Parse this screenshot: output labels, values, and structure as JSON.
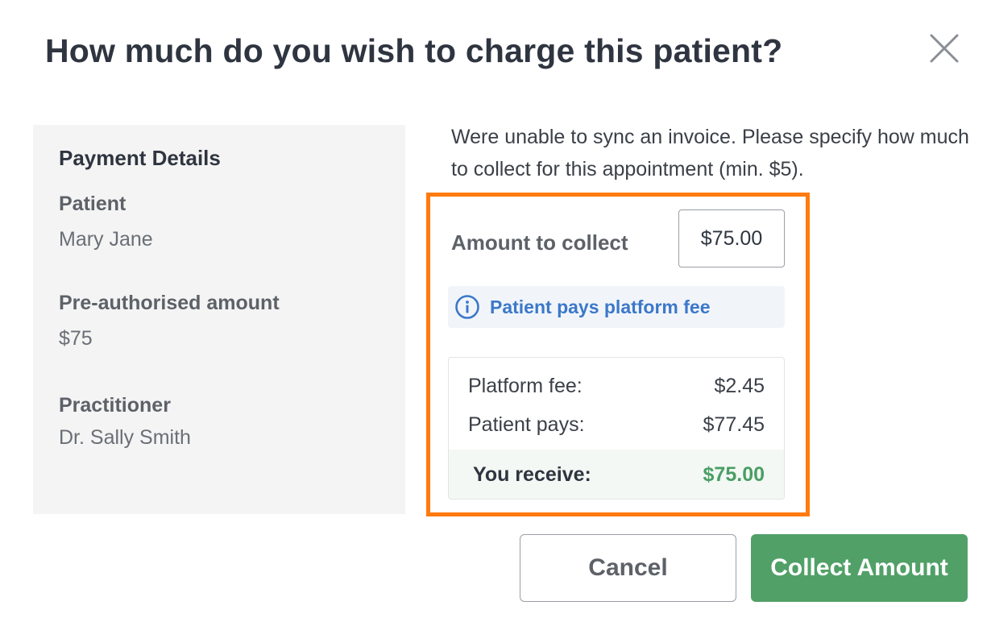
{
  "dialog": {
    "title": "How much do you wish to charge this patient?"
  },
  "details": {
    "heading": "Payment Details",
    "patient_label": "Patient",
    "patient_value": "Mary Jane",
    "preauth_label": "Pre-authorised amount",
    "preauth_value": "$75",
    "practitioner_label": "Practitioner",
    "practitioner_value": "Dr. Sally Smith"
  },
  "instruction": "Were unable to sync an invoice. Please specify how much to collect for this appointment (min. $5).",
  "amount": {
    "label": "Amount to collect",
    "value": "$75.00"
  },
  "fee_notice": {
    "text": "Patient pays platform fee",
    "icon": "info-icon"
  },
  "breakdown": {
    "platform_fee_label": "Platform fee:",
    "platform_fee_value": "$2.45",
    "patient_pays_label": "Patient pays:",
    "patient_pays_value": "$77.45",
    "you_receive_label": "You receive:",
    "you_receive_value": "$75.00"
  },
  "buttons": {
    "cancel": "Cancel",
    "collect": "Collect Amount"
  },
  "colors": {
    "highlight": "#ff7a0f",
    "primary": "#51a067",
    "info": "#3c78c9"
  }
}
